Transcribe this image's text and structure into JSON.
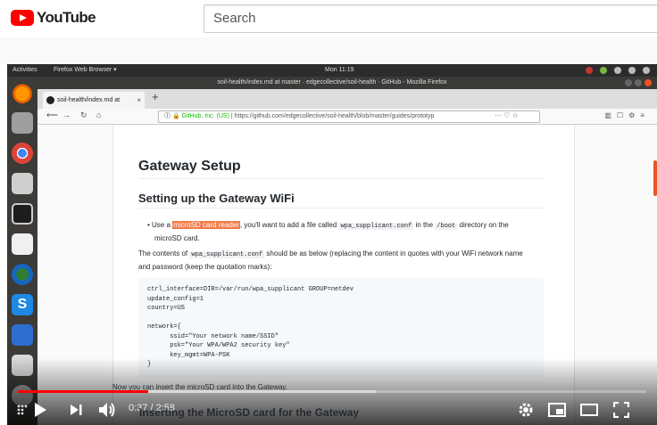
{
  "youtube": {
    "logo_text": "YouTube",
    "search_placeholder": "Search"
  },
  "desktop": {
    "activities": "Activities",
    "app_menu": "Firefox Web Browser ▾",
    "clock": "Mon 11:19"
  },
  "firefox": {
    "window_title": "soil-health/index.md at master · edgecollective/soil-health · GitHub - Mozilla Firefox",
    "tab_title": "soil-health/index.md at",
    "url_org": "GitHub, Inc. (US)",
    "url_path": "https://github.com/edgecollective/soil-health/blob/master/guides/prototyp",
    "url_extra": "··· ♡ ☆"
  },
  "doc": {
    "h1": "Gateway Setup",
    "h2": "Setting up the Gateway WiFi",
    "bullet_prefix": "Use a ",
    "bullet_highlight": "microSD card reader",
    "bullet_mid": ", you'll want to add a file called ",
    "bullet_code1": "wpa_supplicant.conf",
    "bullet_in": " in the ",
    "bullet_code2": "/boot",
    "bullet_suffix": " directory on the",
    "bullet_line2": "microSD card.",
    "para_prefix": "The contents of ",
    "para_code": "wpa_supplicant.conf",
    "para_suffix": " should be as below (replacing the content in quotes with your WiFi network name",
    "para_line2": "and password (keep the quotation marks):",
    "code_block": "ctrl_interface=DIR=/var/run/wpa_supplicant GROUP=netdev\nupdate_config=1\ncountry=US\n\nnetwork={\n      ssid=\"Your network name/SSID\"\n      psk=\"Your WPA/WPA2 security key\"\n      key_mgmt=WPA-PSK\n}",
    "after_code": "Now you can insert the microSD card into the Gateway.",
    "next_heading": "Inserting the MicroSD card for the Gateway"
  },
  "player": {
    "time_display": "0:37 / 2:58",
    "progress_fraction": 0.207,
    "buffered_fraction": 0.57,
    "accent": "#ff0000"
  }
}
